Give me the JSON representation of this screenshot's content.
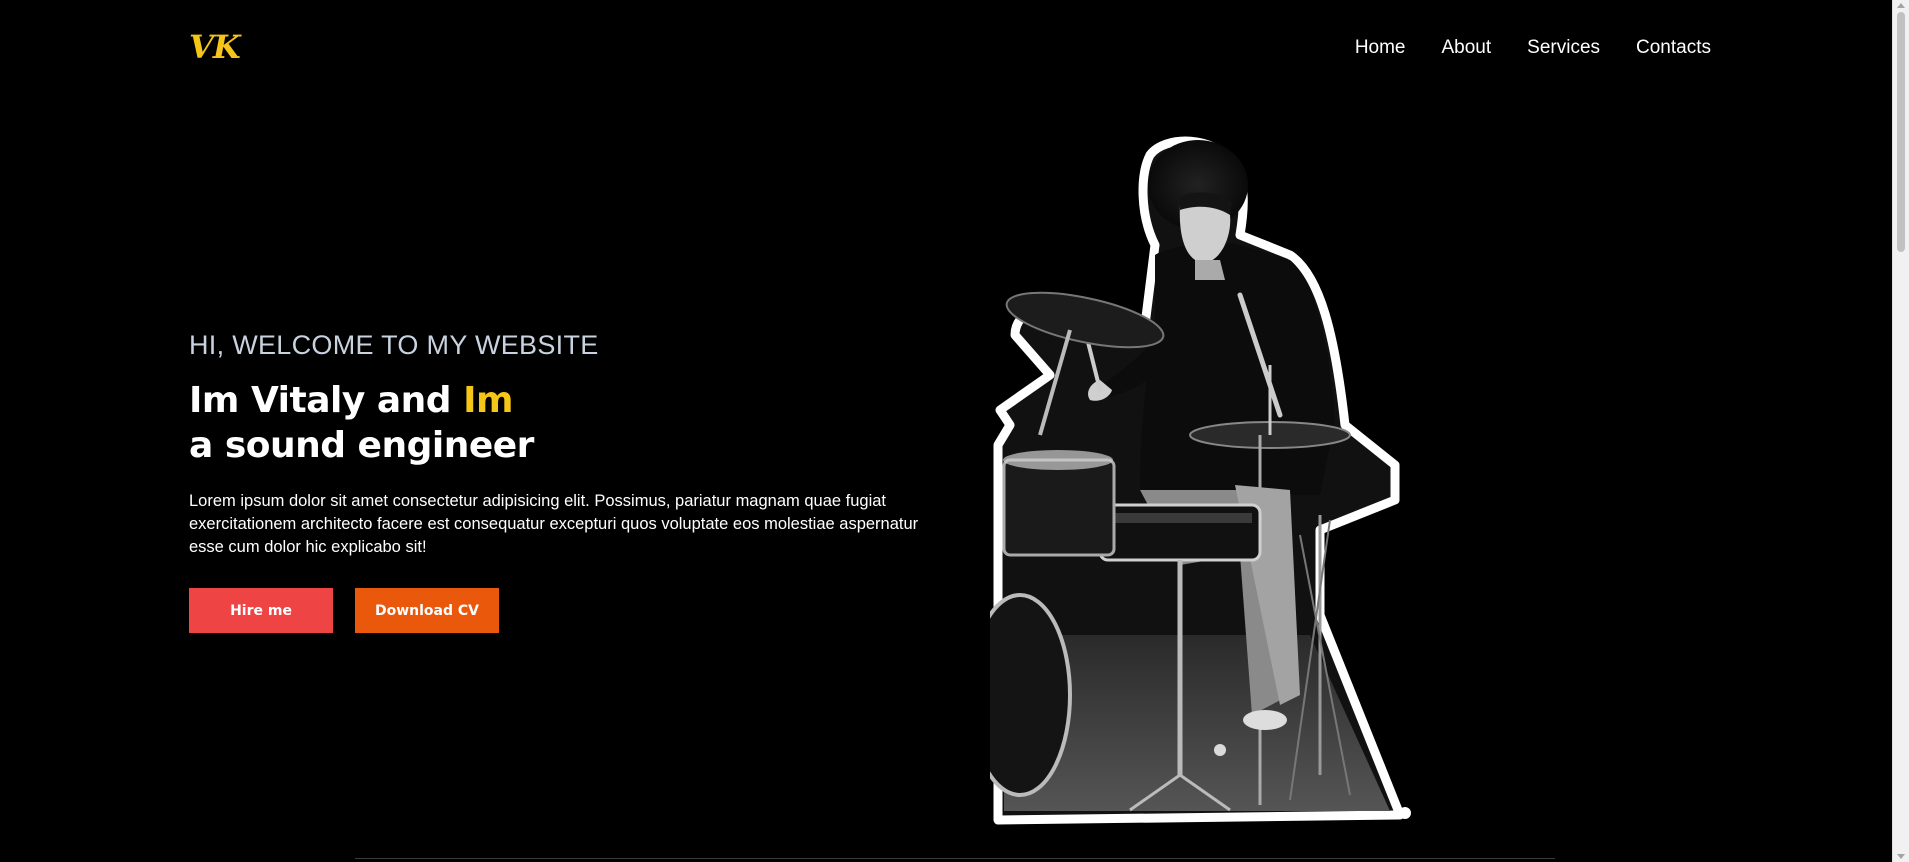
{
  "header": {
    "logo": "VK",
    "nav": [
      "Home",
      "About",
      "Services",
      "Contacts"
    ]
  },
  "hero": {
    "welcome": "HI, WELCOME TO MY WEBSITE",
    "heading_line1_a": "Im Vitaly and ",
    "heading_line1_b": "Im",
    "heading_line2": "a sound engineer",
    "description": "Lorem ipsum dolor sit amet consectetur adipisicing elit. Possimus, pariatur magnam quae fugiat exercitationem architecto facere est consequatur excepturi quos voluptate eos molestiae aspernatur esse cum dolor hic explicabo sit!",
    "hire_button": "Hire me",
    "cv_button": "Download CV",
    "photo_icon": "drummer-photo"
  },
  "colors": {
    "background": "#000000",
    "accent_yellow": "#f5c518",
    "hire_red": "#ef4444",
    "cv_orange": "#ea580c"
  }
}
